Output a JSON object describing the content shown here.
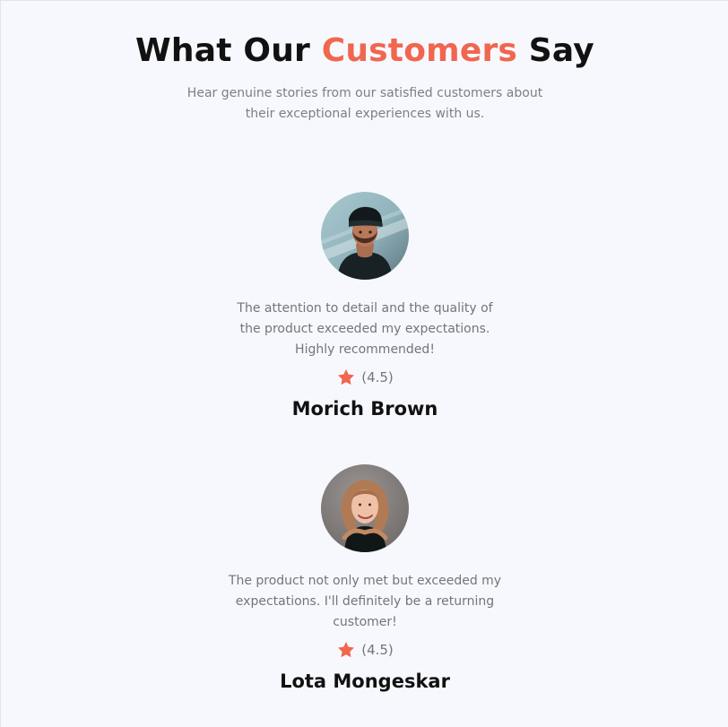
{
  "header": {
    "title_prefix": "What Our",
    "title_accent": "Customers",
    "title_suffix": "Say",
    "subtitle": "Hear genuine stories from our satisfied customers about their exceptional experiences with us."
  },
  "colors": {
    "accent": "#f0664f",
    "background": "#f7f8fd",
    "text_muted": "#75757c"
  },
  "testimonials": [
    {
      "avatar_icon": "customer-avatar-photo",
      "quote": "The attention to detail and the quality of the product exceeded my expectations. Highly recommended!",
      "rating_icon": "star-icon",
      "rating": "(4.5)",
      "name": "Morich Brown"
    },
    {
      "avatar_icon": "customer-avatar-photo",
      "quote": "The product not only met but exceeded my expectations. I'll definitely be a returning customer!",
      "rating_icon": "star-icon",
      "rating": "(4.5)",
      "name": "Lota Mongeskar"
    }
  ]
}
